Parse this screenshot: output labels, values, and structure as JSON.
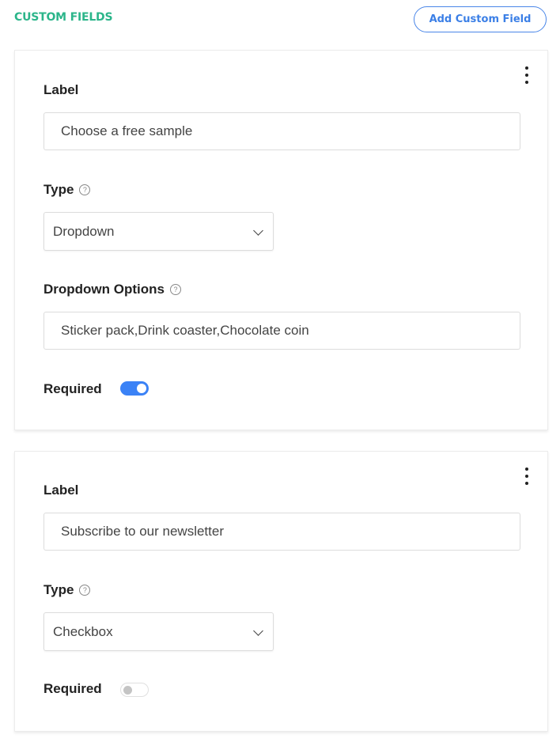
{
  "header": {
    "title": "CUSTOM FIELDS",
    "add_button_label": "Add Custom Field"
  },
  "fields": [
    {
      "label_heading": "Label",
      "label_value": "Choose a free sample",
      "type_heading": "Type",
      "type_value": "Dropdown",
      "options_heading": "Dropdown Options",
      "options_value": "Sticker pack,Drink coaster,Chocolate coin",
      "required_heading": "Required",
      "required": true
    },
    {
      "label_heading": "Label",
      "label_value": "Subscribe to our newsletter",
      "type_heading": "Type",
      "type_value": "Checkbox",
      "required_heading": "Required",
      "required": false
    }
  ],
  "icons": {
    "help": "?",
    "more": "kebab-menu",
    "chevron": "chevron-down"
  },
  "colors": {
    "title": "#2bb58a",
    "accent": "#3b82f6"
  }
}
